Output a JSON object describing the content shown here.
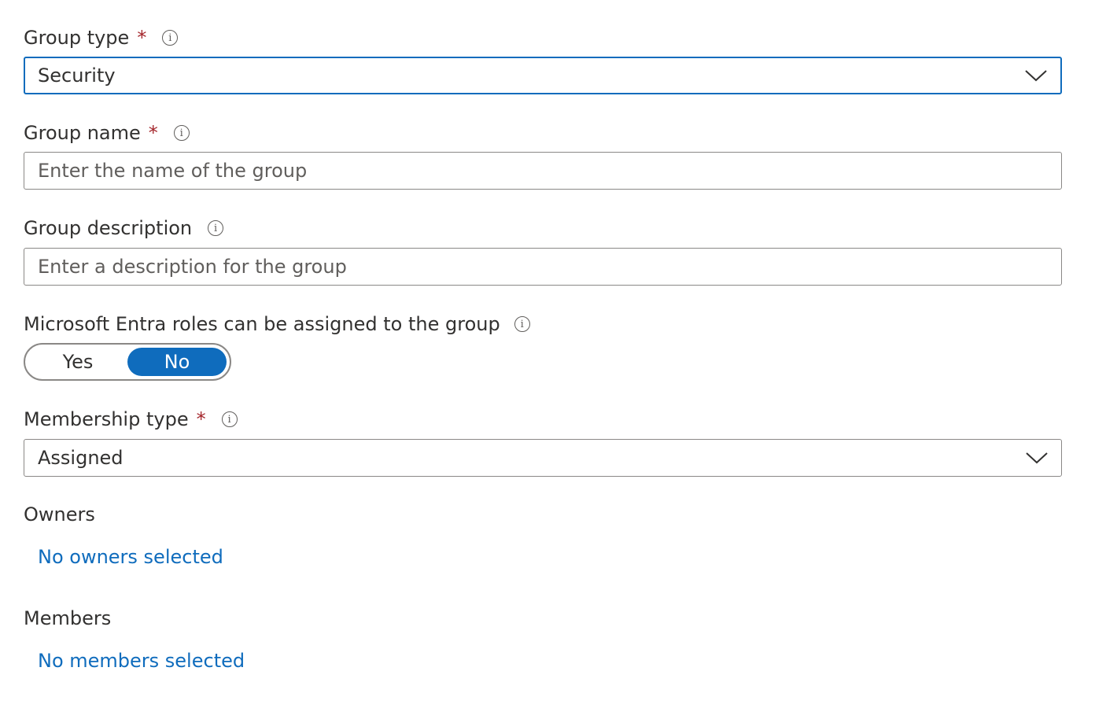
{
  "group_type": {
    "label": "Group type",
    "required_mark": "*",
    "info_glyph": "i",
    "selected_value": "Security"
  },
  "group_name": {
    "label": "Group name",
    "required_mark": "*",
    "info_glyph": "i",
    "placeholder": "Enter the name of the group",
    "value": ""
  },
  "group_description": {
    "label": "Group description",
    "info_glyph": "i",
    "placeholder": "Enter a description for the group",
    "value": ""
  },
  "entra_roles": {
    "label": "Microsoft Entra roles can be assigned to the group",
    "info_glyph": "i",
    "options": [
      "Yes",
      "No"
    ],
    "selected": "No"
  },
  "membership_type": {
    "label": "Membership type",
    "required_mark": "*",
    "info_glyph": "i",
    "selected_value": "Assigned"
  },
  "owners": {
    "label": "Owners",
    "link_text": "No owners selected"
  },
  "members": {
    "label": "Members",
    "link_text": "No members selected"
  },
  "colors": {
    "accent": "#0f6cbd",
    "required": "#a4262c",
    "border": "#8a8886",
    "text": "#323130",
    "placeholder": "#605e5c"
  },
  "icons": {
    "info": "info-icon",
    "dropdown": "chevron-down-icon"
  }
}
